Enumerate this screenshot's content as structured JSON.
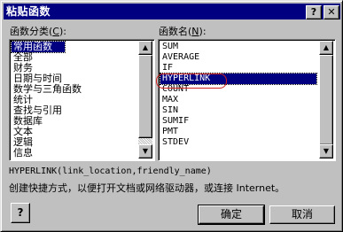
{
  "window": {
    "title": "粘贴函数",
    "help_button": "?",
    "close_button": "✕"
  },
  "category": {
    "label": "函数分类",
    "accel": "C",
    "items": [
      "常用函数",
      "全部",
      "财务",
      "日期与时间",
      "数学与三角函数",
      "统计",
      "查找与引用",
      "数据库",
      "文本",
      "逻辑",
      "信息"
    ],
    "selected": "常用函数"
  },
  "function": {
    "label": "函数名",
    "accel": "N",
    "items": [
      "SUM",
      "AVERAGE",
      "IF",
      "HYPERLINK",
      "COUNT",
      "MAX",
      "SIN",
      "SUMIF",
      "PMT",
      "STDEV"
    ],
    "selected": "HYPERLINK"
  },
  "signature": "HYPERLINK(link_location,friendly_name)",
  "description": "创建快捷方式，以便打开文档或网络驱动器，或连接 Internet。",
  "buttons": {
    "help_icon_text": "?",
    "ok": "确定",
    "cancel": "取消"
  }
}
